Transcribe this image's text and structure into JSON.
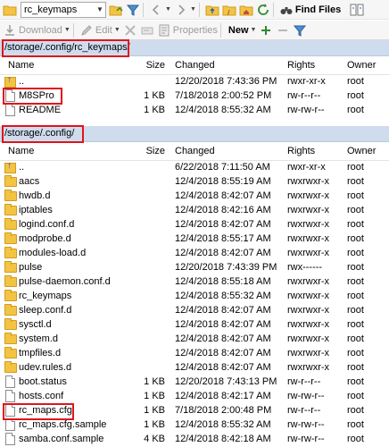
{
  "toolbar1": {
    "folder_combo_value": "rc_keymaps",
    "find_files_label": "Find Files"
  },
  "toolbar2": {
    "download_label": "Download",
    "edit_label": "Edit",
    "properties_label": "Properties",
    "new_label": "New"
  },
  "panel1": {
    "path": "/storage/.config/rc_keymaps/",
    "headers": {
      "name": "Name",
      "size": "Size",
      "changed": "Changed",
      "rights": "Rights",
      "owner": "Owner"
    },
    "rows": [
      {
        "name": "..",
        "size": "",
        "changed": "12/20/2018 7:43:36 PM",
        "rights": "rwxr-xr-x",
        "owner": "root",
        "type": "up"
      },
      {
        "name": "M8SPro",
        "size": "1 KB",
        "changed": "7/18/2018 2:00:52 PM",
        "rights": "rw-r--r--",
        "owner": "root",
        "type": "file"
      },
      {
        "name": "README",
        "size": "1 KB",
        "changed": "12/4/2018 8:55:32 AM",
        "rights": "rw-rw-r--",
        "owner": "root",
        "type": "file"
      }
    ]
  },
  "panel2": {
    "path": "/storage/.config/",
    "headers": {
      "name": "Name",
      "size": "Size",
      "changed": "Changed",
      "rights": "Rights",
      "owner": "Owner"
    },
    "rows": [
      {
        "name": "..",
        "size": "",
        "changed": "6/22/2018 7:11:50 AM",
        "rights": "rwxr-xr-x",
        "owner": "root",
        "type": "up"
      },
      {
        "name": "aacs",
        "size": "",
        "changed": "12/4/2018 8:55:19 AM",
        "rights": "rwxrwxr-x",
        "owner": "root",
        "type": "folder"
      },
      {
        "name": "hwdb.d",
        "size": "",
        "changed": "12/4/2018 8:42:07 AM",
        "rights": "rwxrwxr-x",
        "owner": "root",
        "type": "folder"
      },
      {
        "name": "iptables",
        "size": "",
        "changed": "12/4/2018 8:42:16 AM",
        "rights": "rwxrwxr-x",
        "owner": "root",
        "type": "folder"
      },
      {
        "name": "logind.conf.d",
        "size": "",
        "changed": "12/4/2018 8:42:07 AM",
        "rights": "rwxrwxr-x",
        "owner": "root",
        "type": "folder"
      },
      {
        "name": "modprobe.d",
        "size": "",
        "changed": "12/4/2018 8:55:17 AM",
        "rights": "rwxrwxr-x",
        "owner": "root",
        "type": "folder"
      },
      {
        "name": "modules-load.d",
        "size": "",
        "changed": "12/4/2018 8:42:07 AM",
        "rights": "rwxrwxr-x",
        "owner": "root",
        "type": "folder"
      },
      {
        "name": "pulse",
        "size": "",
        "changed": "12/20/2018 7:43:39 PM",
        "rights": "rwx------",
        "owner": "root",
        "type": "folder"
      },
      {
        "name": "pulse-daemon.conf.d",
        "size": "",
        "changed": "12/4/2018 8:55:18 AM",
        "rights": "rwxrwxr-x",
        "owner": "root",
        "type": "folder"
      },
      {
        "name": "rc_keymaps",
        "size": "",
        "changed": "12/4/2018 8:55:32 AM",
        "rights": "rwxrwxr-x",
        "owner": "root",
        "type": "folder"
      },
      {
        "name": "sleep.conf.d",
        "size": "",
        "changed": "12/4/2018 8:42:07 AM",
        "rights": "rwxrwxr-x",
        "owner": "root",
        "type": "folder"
      },
      {
        "name": "sysctl.d",
        "size": "",
        "changed": "12/4/2018 8:42:07 AM",
        "rights": "rwxrwxr-x",
        "owner": "root",
        "type": "folder"
      },
      {
        "name": "system.d",
        "size": "",
        "changed": "12/4/2018 8:42:07 AM",
        "rights": "rwxrwxr-x",
        "owner": "root",
        "type": "folder"
      },
      {
        "name": "tmpfiles.d",
        "size": "",
        "changed": "12/4/2018 8:42:07 AM",
        "rights": "rwxrwxr-x",
        "owner": "root",
        "type": "folder"
      },
      {
        "name": "udev.rules.d",
        "size": "",
        "changed": "12/4/2018 8:42:07 AM",
        "rights": "rwxrwxr-x",
        "owner": "root",
        "type": "folder"
      },
      {
        "name": "boot.status",
        "size": "1 KB",
        "changed": "12/20/2018 7:43:13 PM",
        "rights": "rw-r--r--",
        "owner": "root",
        "type": "file"
      },
      {
        "name": "hosts.conf",
        "size": "1 KB",
        "changed": "12/4/2018 8:42:17 AM",
        "rights": "rw-rw-r--",
        "owner": "root",
        "type": "file"
      },
      {
        "name": "rc_maps.cfg",
        "size": "1 KB",
        "changed": "7/18/2018 2:00:48 PM",
        "rights": "rw-r--r--",
        "owner": "root",
        "type": "file"
      },
      {
        "name": "rc_maps.cfg.sample",
        "size": "1 KB",
        "changed": "12/4/2018 8:55:32 AM",
        "rights": "rw-rw-r--",
        "owner": "root",
        "type": "file"
      },
      {
        "name": "samba.conf.sample",
        "size": "4 KB",
        "changed": "12/4/2018 8:42:18 AM",
        "rights": "rw-rw-r--",
        "owner": "root",
        "type": "file"
      }
    ]
  },
  "colors": {
    "highlight": "#e0151b",
    "path_bar": "#cfdcee",
    "folder": "#f3c443"
  }
}
